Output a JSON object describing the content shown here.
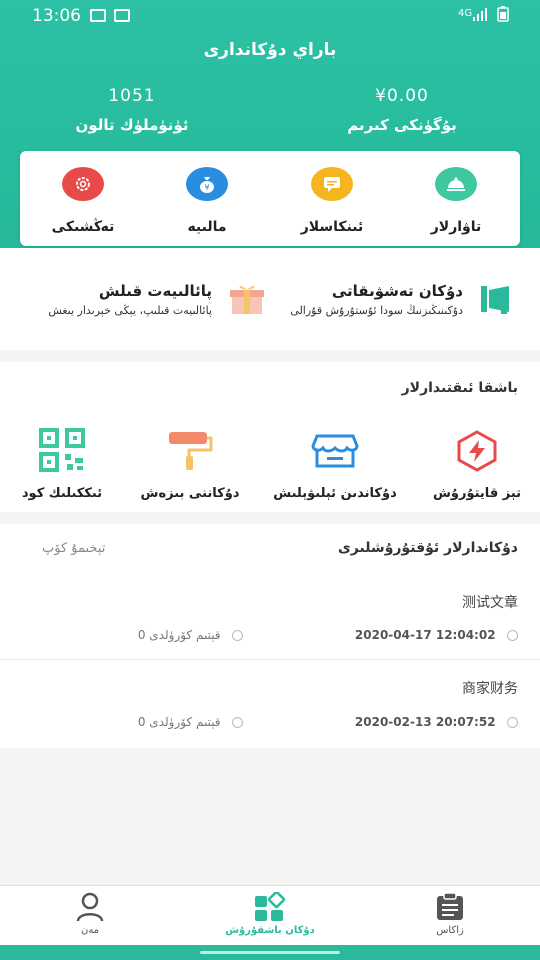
{
  "status_bar": {
    "time": "13:06",
    "network": "4G"
  },
  "header": {
    "title": "باراي دۇكاندارى",
    "balance_value": "¥0.00",
    "balance_label": "بۇگۈنكى كىرىم",
    "coupon_value": "1051",
    "coupon_label": "ئۈنۈملۈك تالون"
  },
  "quick_actions": [
    {
      "label": "تاۋارلار",
      "icon": "dish-icon",
      "color": "#3ec89f"
    },
    {
      "label": "ئىنكاسلار",
      "icon": "comment-icon",
      "color": "#f5b51f"
    },
    {
      "label": "مالىيە",
      "icon": "money-bag-icon",
      "color": "#2a8de0"
    },
    {
      "label": "تەڭشىكى",
      "icon": "settings-icon",
      "color": "#e84a4a"
    }
  ],
  "promos": [
    {
      "title": "دۇكان تەشۋىقاتى",
      "subtitle": "دۇكىنىڭىزنىڭ سودا ئۇستۇرۇش قۇرالى",
      "icon": "megaphone-icon"
    },
    {
      "title": "پائالىيەت قىلش",
      "subtitle": "پائالىيەت قىلىپ، يېڭى خېرىدار يىغش",
      "icon": "gift-icon"
    }
  ],
  "manage": {
    "title": "باشقا ئىقتىدارلار",
    "tools": [
      {
        "label": "تېز قايتۇرۇش",
        "icon": "flash-icon"
      },
      {
        "label": "دۇكاندىن ئېلىۋېلىش",
        "icon": "store-icon"
      },
      {
        "label": "دۇكاننى بىزەش",
        "icon": "paint-roller-icon"
      },
      {
        "label": "ئىككىلىك كود",
        "icon": "qr-code-icon"
      }
    ]
  },
  "articles": {
    "title": "دۇكاندارلار ئۇقتۇرۇشلىرى",
    "more": "تېخىمۇ كۆپ",
    "items": [
      {
        "title": "测试文章",
        "time": "2020-04-17 12:04:02",
        "views": "0 قېتىم كۆرۈلدى"
      },
      {
        "title": "商家财务",
        "time": "2020-02-13 20:07:52",
        "views": "0 قېتىم كۆرۈلدى"
      }
    ]
  },
  "tabbar": [
    {
      "label": "زاكاس",
      "icon": "clipboard-icon"
    },
    {
      "label": "دۇكان باشقۇرۇش",
      "icon": "grid-icon"
    },
    {
      "label": "مەن",
      "icon": "user-icon"
    }
  ],
  "colors": {
    "accent": "#2bb99b"
  }
}
